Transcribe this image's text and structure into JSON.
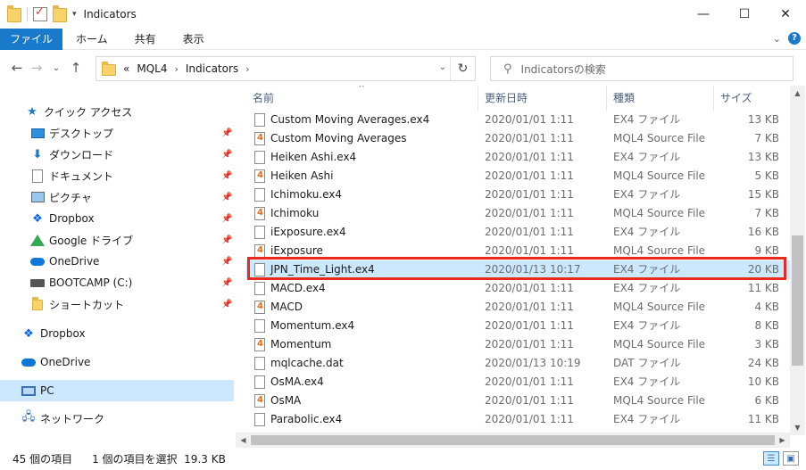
{
  "window": {
    "title": "Indicators"
  },
  "ribbon": {
    "tabs": [
      "ファイル",
      "ホーム",
      "共有",
      "表示"
    ]
  },
  "address": {
    "path": [
      "«",
      "MQL4",
      "Indicators"
    ]
  },
  "search": {
    "placeholder": "Indicatorsの検索"
  },
  "nav": {
    "items": [
      {
        "label": "クイック アクセス",
        "icon": "star-icon"
      },
      {
        "label": "デスクトップ",
        "icon": "desktop-icon",
        "pinned": true
      },
      {
        "label": "ダウンロード",
        "icon": "download-icon",
        "pinned": true
      },
      {
        "label": "ドキュメント",
        "icon": "document-icon",
        "pinned": true
      },
      {
        "label": "ピクチャ",
        "icon": "pictures-icon",
        "pinned": true
      },
      {
        "label": "Dropbox",
        "icon": "dropbox-icon",
        "pinned": true
      },
      {
        "label": "Google ドライブ",
        "icon": "google-drive-icon",
        "pinned": true
      },
      {
        "label": "OneDrive",
        "icon": "onedrive-icon",
        "pinned": true
      },
      {
        "label": "BOOTCAMP (C:)",
        "icon": "drive-icon",
        "pinned": true
      },
      {
        "label": "ショートカット",
        "icon": "folder-icon",
        "pinned": true
      },
      {
        "label": "Dropbox",
        "icon": "dropbox-icon"
      },
      {
        "label": "OneDrive",
        "icon": "onedrive-icon"
      },
      {
        "label": "PC",
        "icon": "pc-icon",
        "selected": true
      },
      {
        "label": "ネットワーク",
        "icon": "network-icon"
      }
    ]
  },
  "columns": [
    "名前",
    "更新日時",
    "種類",
    "サイズ"
  ],
  "files": [
    {
      "name": "Custom Moving Averages.ex4",
      "date": "2020/01/01 1:11",
      "type": "EX4 ファイル",
      "size": "13 KB",
      "kind": "ex4"
    },
    {
      "name": "Custom Moving Averages",
      "date": "2020/01/01 1:11",
      "type": "MQL4 Source File",
      "size": "7 KB",
      "kind": "mq4"
    },
    {
      "name": "Heiken Ashi.ex4",
      "date": "2020/01/01 1:11",
      "type": "EX4 ファイル",
      "size": "13 KB",
      "kind": "ex4"
    },
    {
      "name": "Heiken Ashi",
      "date": "2020/01/01 1:11",
      "type": "MQL4 Source File",
      "size": "5 KB",
      "kind": "mq4"
    },
    {
      "name": "Ichimoku.ex4",
      "date": "2020/01/01 1:11",
      "type": "EX4 ファイル",
      "size": "15 KB",
      "kind": "ex4"
    },
    {
      "name": "Ichimoku",
      "date": "2020/01/01 1:11",
      "type": "MQL4 Source File",
      "size": "7 KB",
      "kind": "mq4"
    },
    {
      "name": "iExposure.ex4",
      "date": "2020/01/01 1:11",
      "type": "EX4 ファイル",
      "size": "16 KB",
      "kind": "ex4"
    },
    {
      "name": "iExposure",
      "date": "2020/01/01 1:11",
      "type": "MQL4 Source File",
      "size": "9 KB",
      "kind": "mq4"
    },
    {
      "name": "JPN_Time_Light.ex4",
      "date": "2020/01/13 10:17",
      "type": "EX4 ファイル",
      "size": "20 KB",
      "kind": "ex4",
      "selected": true
    },
    {
      "name": "MACD.ex4",
      "date": "2020/01/01 1:11",
      "type": "EX4 ファイル",
      "size": "11 KB",
      "kind": "ex4"
    },
    {
      "name": "MACD",
      "date": "2020/01/01 1:11",
      "type": "MQL4 Source File",
      "size": "4 KB",
      "kind": "mq4"
    },
    {
      "name": "Momentum.ex4",
      "date": "2020/01/01 1:11",
      "type": "EX4 ファイル",
      "size": "8 KB",
      "kind": "ex4"
    },
    {
      "name": "Momentum",
      "date": "2020/01/01 1:11",
      "type": "MQL4 Source File",
      "size": "3 KB",
      "kind": "mq4"
    },
    {
      "name": "mqlcache.dat",
      "date": "2020/01/13 10:19",
      "type": "DAT ファイル",
      "size": "24 KB",
      "kind": "dat"
    },
    {
      "name": "OsMA.ex4",
      "date": "2020/01/01 1:11",
      "type": "EX4 ファイル",
      "size": "10 KB",
      "kind": "ex4"
    },
    {
      "name": "OsMA",
      "date": "2020/01/01 1:11",
      "type": "MQL4 Source File",
      "size": "6 KB",
      "kind": "mq4"
    },
    {
      "name": "Parabolic.ex4",
      "date": "2020/01/01 1:11",
      "type": "EX4 ファイル",
      "size": "11 KB",
      "kind": "ex4"
    }
  ],
  "status": {
    "count": "45 個の項目",
    "selection": "1 個の項目を選択  19.3 KB"
  },
  "colors": {
    "accent": "#1979ca",
    "selection": "#cce8ff",
    "highlight": "#e8291c"
  }
}
